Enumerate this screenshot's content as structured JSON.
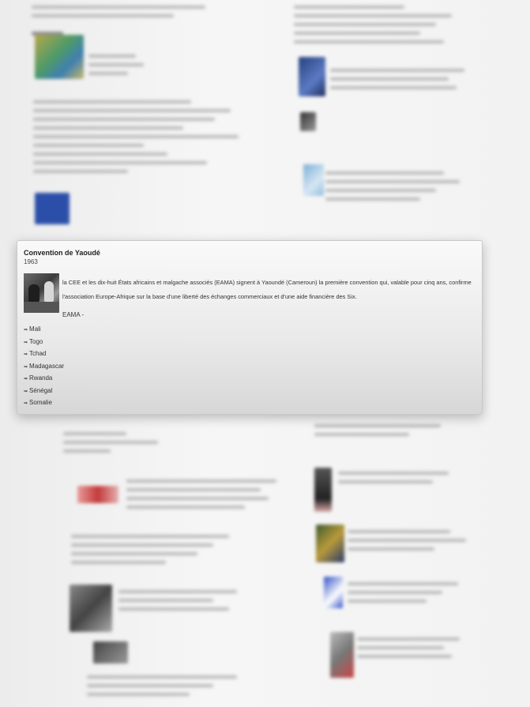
{
  "popup": {
    "title": "Convention de Yaoudé",
    "year": "1963",
    "description": "la CEE et les dix-huit États africains et malgache associés (EAMA) signent à Yaoundé (Cameroun) la première convention qui, valable pour cinq ans, confirme l'association Europe-Afrique sur la base d'une liberté des échanges commerciaux et d'une aide financière des Six.",
    "eama_label": "EAMA -",
    "list_arrow": "➡",
    "countries": [
      "Mali",
      "Togo",
      "Tchad",
      "Madagascar",
      "Rwanda",
      "Sénégal",
      "Somalie"
    ]
  },
  "colors": {
    "eu_blue": "#2b4fa8",
    "background": "#f2f2f2"
  },
  "icons": [
    "photo-thumbnail",
    "eu-flag-thumbnail",
    "map-thumbnail",
    "list-arrow-icon"
  ]
}
